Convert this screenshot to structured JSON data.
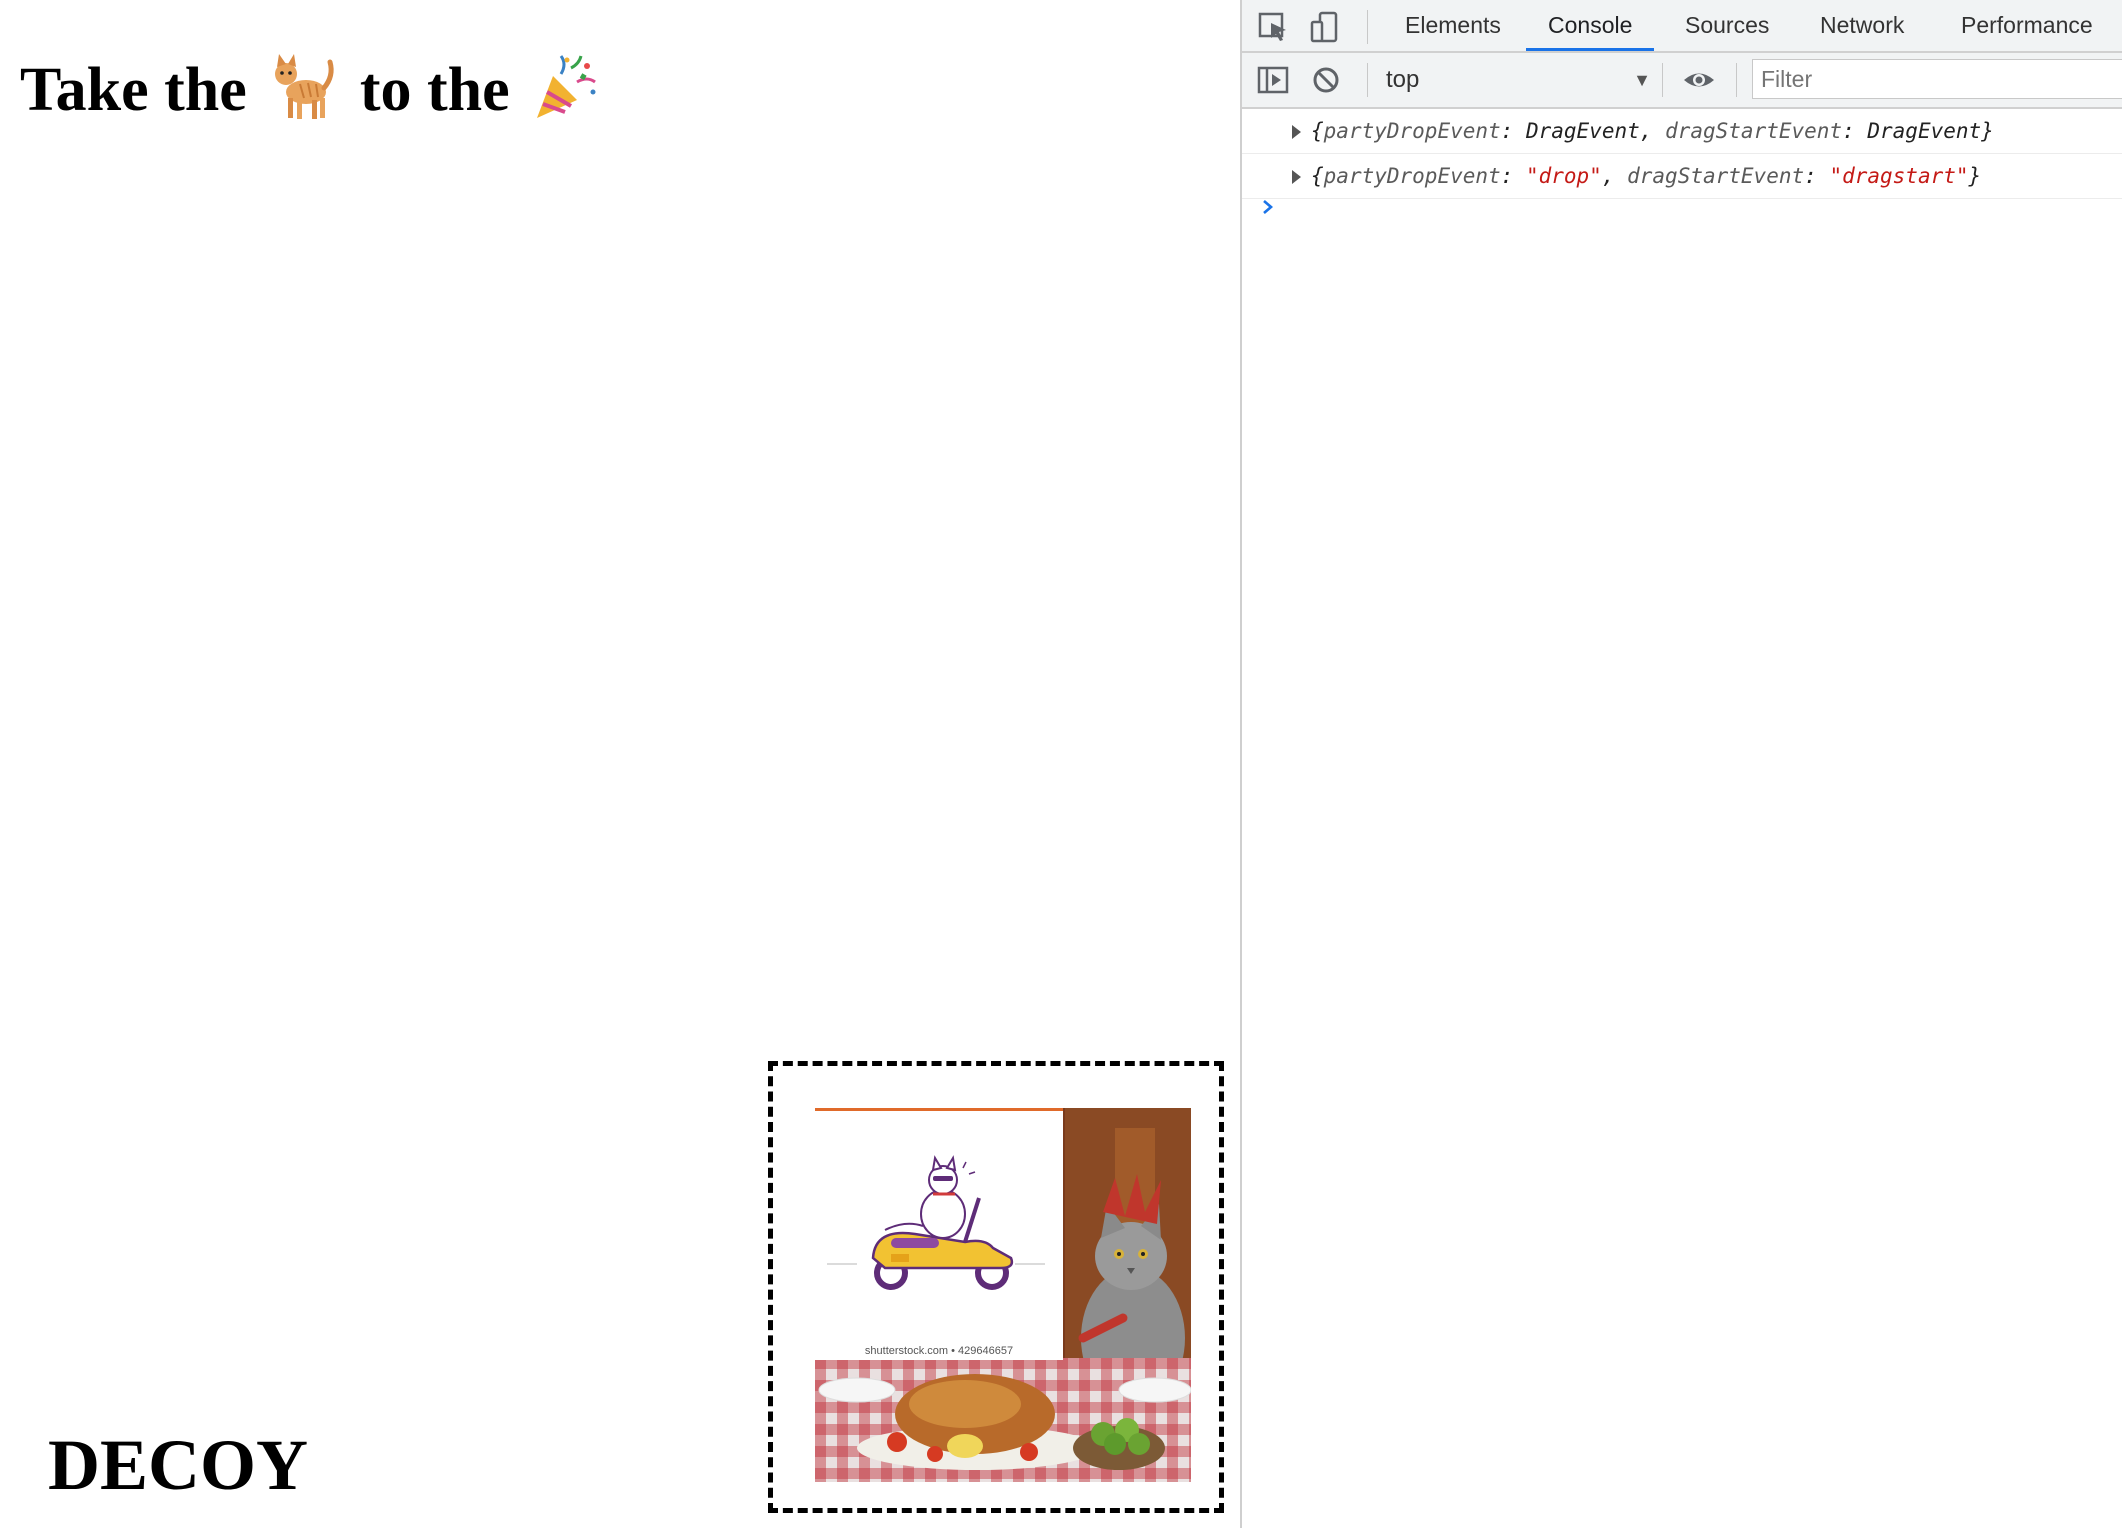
{
  "page": {
    "heading_prefix": "Take the",
    "heading_middle": "to the",
    "cat_emoji_icon": "cat-icon",
    "party_emoji_icon": "party-popper-icon",
    "decoy_text": "DECOY",
    "photo_watermark": "shutterstock.com • 429646657"
  },
  "devtools": {
    "tabs": [
      "Elements",
      "Console",
      "Sources",
      "Network",
      "Performance"
    ],
    "active_tab": "Console",
    "context": "top",
    "filter_placeholder": "Filter",
    "accent_color": "#1a73e8",
    "console_rows": [
      {
        "open": "{",
        "key1": "partyDropEvent",
        "val1": "DragEvent",
        "key2": "dragStartEvent",
        "val2": "DragEvent",
        "close": "}"
      },
      {
        "open": "{",
        "key1": "partyDropEvent",
        "val1": "\"drop\"",
        "key2": "dragStartEvent",
        "val2": "\"dragstart\"",
        "close": "}"
      }
    ]
  }
}
